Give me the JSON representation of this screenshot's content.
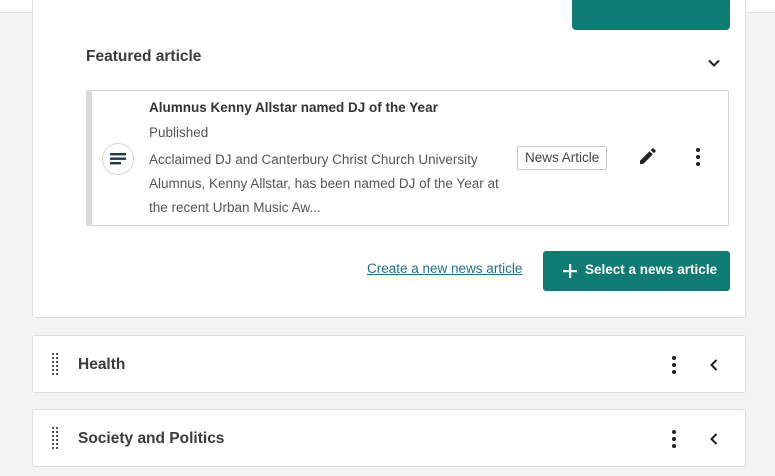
{
  "featured": {
    "title": "Featured article",
    "article": {
      "headline": "Alumnus Kenny Allstar named DJ of the Year",
      "status": "Published",
      "summary": "Acclaimed DJ and Canterbury Christ Church University Alumnus, Kenny Allstar, has been named DJ of the Year at the recent Urban Music Aw...",
      "type_badge": "News Article"
    },
    "create_link": "Create a new news article",
    "select_button": "Select a news article"
  },
  "sections": [
    {
      "title": "Health"
    },
    {
      "title": "Society and Politics"
    }
  ],
  "colors": {
    "accent": "#0e7c72",
    "link": "#1d6f8a"
  },
  "icons": [
    "document-icon",
    "pencil-icon",
    "more-vertical-icon",
    "chevron-down-icon",
    "chevron-left-icon",
    "plus-icon",
    "drag-handle-icon"
  ]
}
